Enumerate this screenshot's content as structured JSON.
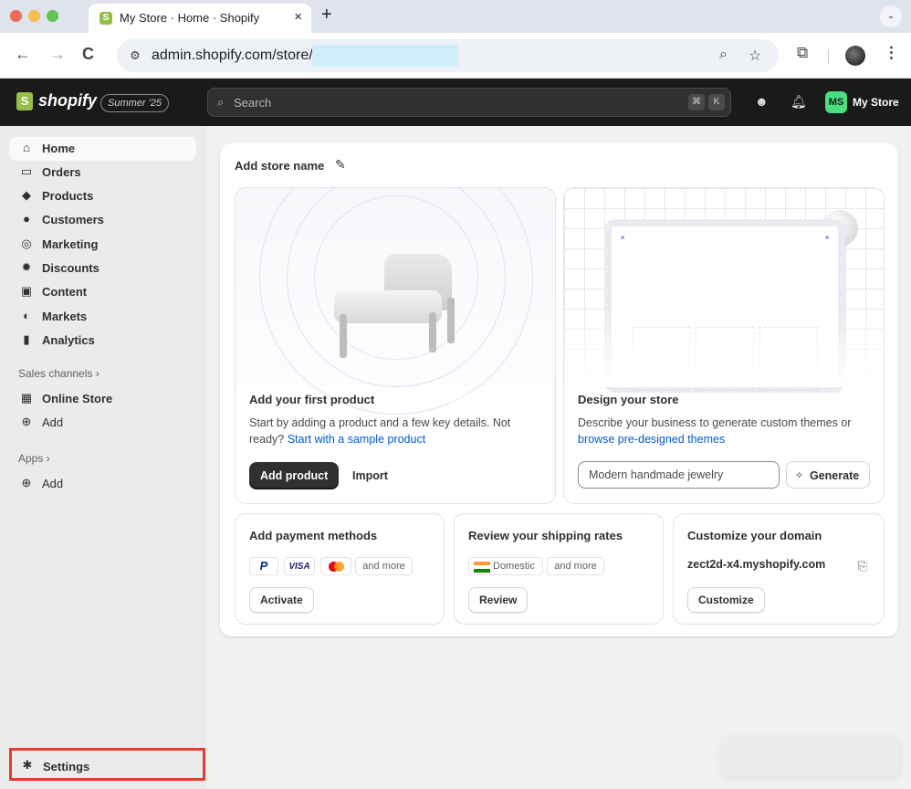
{
  "browser": {
    "tab_title": "My Store · Home · Shopify",
    "tab_close": "×",
    "new_tab": "+",
    "tab_menu": "⌄",
    "url": "admin.shopify.com/store/",
    "back": "←",
    "forward": "→",
    "reload": "C",
    "menu": "⋮"
  },
  "topbar": {
    "brand": "shopify",
    "edition": "Summer '25",
    "search_placeholder": "Search",
    "shortcut_cmd": "⌘",
    "shortcut_key": "K",
    "store_initials": "MS",
    "store_name": "My Store"
  },
  "sidebar": {
    "items": [
      {
        "label": "Home",
        "icon": "home-icon"
      },
      {
        "label": "Orders",
        "icon": "orders-icon"
      },
      {
        "label": "Products",
        "icon": "tag-icon"
      },
      {
        "label": "Customers",
        "icon": "person-icon"
      },
      {
        "label": "Marketing",
        "icon": "target-icon"
      },
      {
        "label": "Discounts",
        "icon": "discount-icon"
      },
      {
        "label": "Content",
        "icon": "content-icon"
      },
      {
        "label": "Markets",
        "icon": "globe-icon"
      },
      {
        "label": "Analytics",
        "icon": "bar-chart-icon"
      }
    ],
    "sales_channels_head": "Sales channels ›",
    "online_store": "Online Store",
    "add_channel": "Add",
    "apps_head": "Apps ›",
    "add_app": "Add",
    "settings": "Settings"
  },
  "main": {
    "store_title": "Add store name",
    "product_card": {
      "title": "Add your first product",
      "text": "Start by adding a product and a few key details. Not ready?",
      "link": "Start with a sample product",
      "primary": "Add product",
      "secondary": "Import"
    },
    "design_card": {
      "title": "Design your store",
      "text": "Describe your business to generate custom themes or",
      "link": "browse pre-designed themes",
      "input_value": "Modern handmade jewelry",
      "generate": "Generate"
    },
    "payment_card": {
      "title": "Add payment methods",
      "chips": [
        "P",
        "VISA",
        "",
        "and more"
      ],
      "button": "Activate"
    },
    "shipping_card": {
      "title": "Review your shipping rates",
      "chips": [
        "Domestic",
        "and more"
      ],
      "button": "Review"
    },
    "domain_card": {
      "title": "Customize your domain",
      "domain": "zect2d-x4.myshopify.com",
      "button": "Customize"
    }
  }
}
